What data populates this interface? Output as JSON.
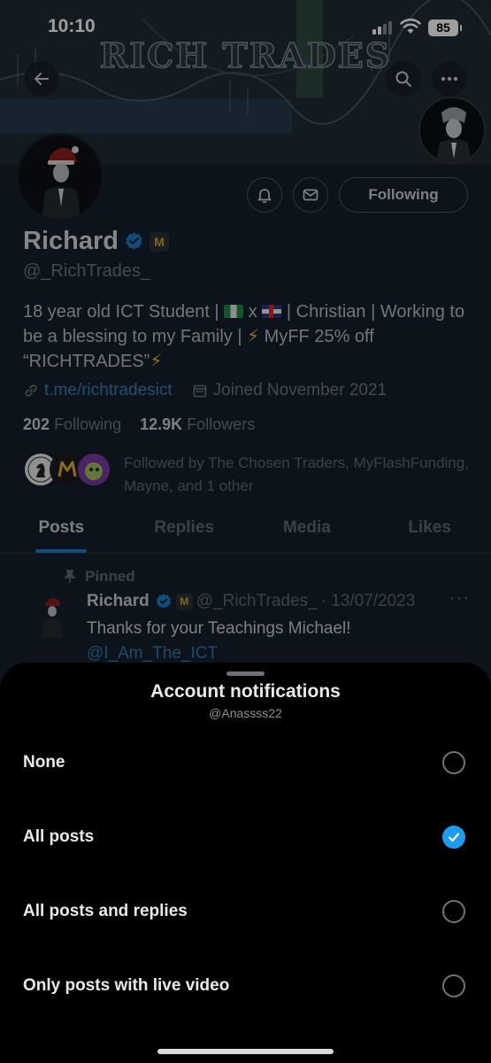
{
  "status_bar": {
    "time": "10:10",
    "battery": "85"
  },
  "banner": {
    "title": "RICH TRADES"
  },
  "profile": {
    "name": "Richard",
    "handle": "@_RichTrades_",
    "badge_letter": "M",
    "following_button": "Following",
    "bio": {
      "part1": "18 year old ICT Student | ",
      "sep": " x ",
      "part2": " | Christian | Working to be a blessing to my Family | ",
      "part3": " MyFF 25% off “RICHTRADES”"
    },
    "link": "t.me/richtradesict",
    "joined": "Joined November 2021",
    "following_count": "202",
    "following_label": "Following",
    "followers_count": "12.9K",
    "followers_label": "Followers",
    "followed_by": "Followed by The Chosen Traders, MyFlashFunding, Mayne, and 1 other"
  },
  "tabs": [
    {
      "label": "Posts"
    },
    {
      "label": "Replies"
    },
    {
      "label": "Media"
    },
    {
      "label": "Likes"
    }
  ],
  "pinned_post": {
    "pinned_label": "Pinned",
    "author": "Richard",
    "handle": "@_RichTrades_",
    "date": "· 13/07/2023",
    "text": "Thanks for your Teachings Michael!",
    "mention": "@I_Am_The_ICT"
  },
  "sheet": {
    "title": "Account notifications",
    "subtitle": "@Anassss22",
    "options": [
      {
        "label": "None",
        "selected": false
      },
      {
        "label": "All posts",
        "selected": true
      },
      {
        "label": "All posts and replies",
        "selected": false
      },
      {
        "label": "Only posts with live video",
        "selected": false
      }
    ]
  },
  "colors": {
    "accent": "#1d9bf0",
    "sheet_bg": "#000000",
    "profile_bg": "#15202b"
  }
}
